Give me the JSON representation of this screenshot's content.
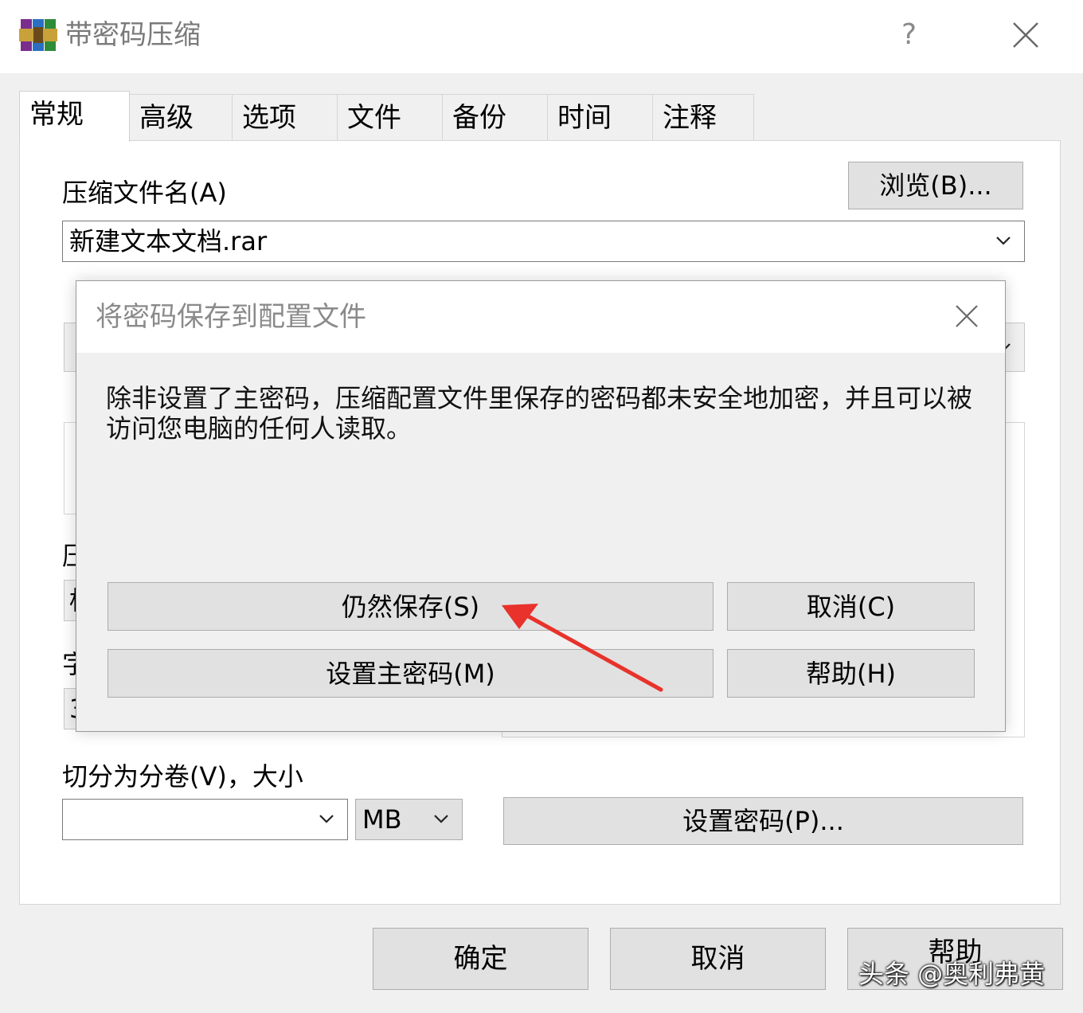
{
  "window": {
    "title": "带密码压缩",
    "help_glyph": "?",
    "close_icon": "close-icon"
  },
  "tabs": [
    {
      "label": "常规",
      "active": true
    },
    {
      "label": "高级"
    },
    {
      "label": "选项"
    },
    {
      "label": "文件"
    },
    {
      "label": "备份"
    },
    {
      "label": "时间"
    },
    {
      "label": "注释"
    }
  ],
  "general": {
    "archive_name_label": "压缩文件名(A)",
    "browse_label": "浏览(B)...",
    "archive_name_value": "新建文本文档.rar",
    "partial_label_1": "压",
    "partial_value_1": "标",
    "partial_label_2": "字",
    "partial_value_2": "3",
    "split_label": "切分为分卷(V)，大小",
    "split_value": "",
    "split_unit": "MB",
    "set_password_label": "设置密码(P)..."
  },
  "modal": {
    "title": "将密码保存到配置文件",
    "message": "除非设置了主密码，压缩配置文件里保存的密码都未安全地加密，并且可以被访问您电脑的任何人读取。",
    "save_anyway": "仍然保存(S)",
    "cancel": "取消(C)",
    "set_master": "设置主密码(M)",
    "help": "帮助(H)"
  },
  "footer": {
    "ok": "确定",
    "cancel": "取消",
    "help": "帮助"
  },
  "watermark": "头条 @奥利弗黄",
  "colors": {
    "annotation_arrow": "#e8322b",
    "window_bg": "#f0f0f0",
    "button_bg": "#e1e1e1"
  }
}
